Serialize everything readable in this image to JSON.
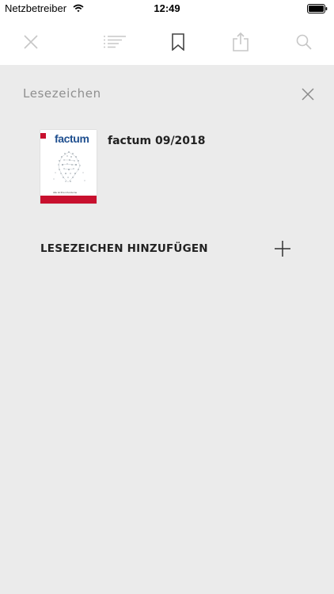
{
  "status_bar": {
    "carrier": "Netzbetreiber",
    "time": "12:49"
  },
  "toolbar": {
    "buttons": [
      {
        "icon": "close-icon",
        "active": false
      },
      {
        "icon": "table-of-contents-icon",
        "active": false
      },
      {
        "icon": "bookmark-icon",
        "active": true
      },
      {
        "icon": "share-icon",
        "active": false
      },
      {
        "icon": "search-icon",
        "active": false
      }
    ],
    "inactive_color": "#c7c7c7",
    "active_color": "#444444"
  },
  "bookmarks_panel": {
    "title": "Lesezeichen",
    "items": [
      {
        "title": "factum 09/2018",
        "cover": {
          "logo_text": "factum",
          "caption": "Alle ist Ihren Konzerne",
          "accent_color": "#c8102e",
          "logo_color": "#1f4f8f"
        }
      }
    ],
    "add_label": "LESEZEICHEN HINZUFÜGEN"
  },
  "colors": {
    "background": "#ebebeb",
    "toolbar_bg": "#ffffff"
  }
}
